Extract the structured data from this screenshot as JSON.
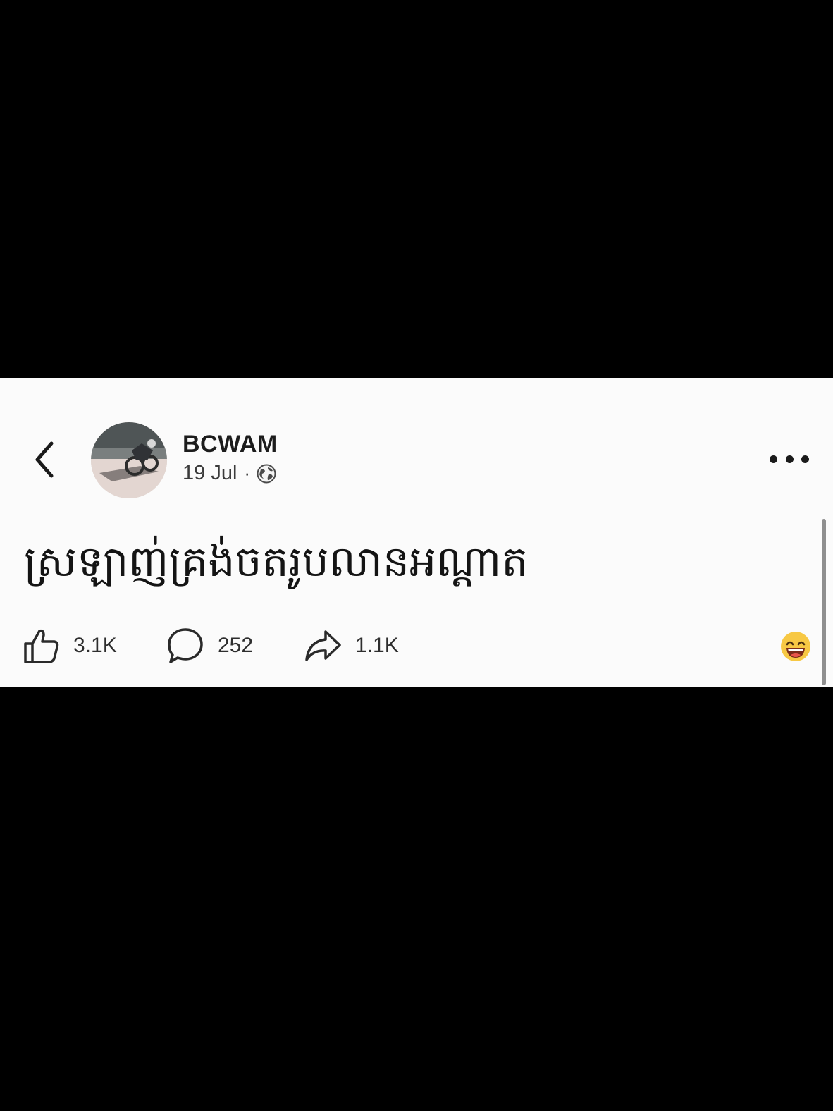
{
  "post": {
    "author": "BCWAM",
    "date": "19 Jul",
    "separator": "·",
    "text": "ស្រឡាញ់គ្រង់ចតរូបលានអណ្ដាត",
    "likes": "3.1K",
    "comments": "252",
    "shares": "1.1K"
  },
  "icons": {
    "back": "chevron-left-icon",
    "privacy": "globe-icon",
    "more": "ellipsis-icon",
    "like": "thumbs-up-icon",
    "comment": "comment-bubble-icon",
    "share": "share-arrow-icon",
    "reaction": "grinning-face-emoji"
  },
  "colors": {
    "page_background": "#000000",
    "card_background": "#fbfbfb",
    "text": "#141414"
  }
}
